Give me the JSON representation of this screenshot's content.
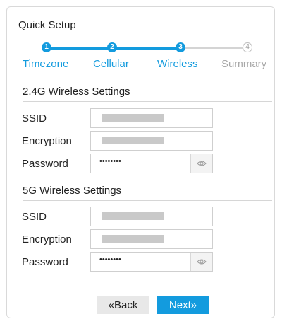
{
  "header": {
    "title": "Quick Setup"
  },
  "stepper": {
    "steps": [
      {
        "number": "1",
        "label": "Timezone"
      },
      {
        "number": "2",
        "label": "Cellular"
      },
      {
        "number": "3",
        "label": "Wireless"
      },
      {
        "number": "4",
        "label": "Summary"
      }
    ],
    "current_step": 3
  },
  "sections": [
    {
      "heading": "2.4G Wireless Settings",
      "fields": {
        "ssid_label": "SSID",
        "encryption_label": "Encryption",
        "password_label": "Password",
        "password_value": "••••••••"
      }
    },
    {
      "heading": "5G Wireless Settings",
      "fields": {
        "ssid_label": "SSID",
        "encryption_label": "Encryption",
        "password_label": "Password",
        "password_value": "••••••••"
      }
    }
  ],
  "buttons": {
    "back": "«Back",
    "next": "Next»"
  },
  "colors": {
    "accent": "#139bde",
    "inactive": "#a8a8a8",
    "border": "#d9d9d9"
  },
  "icons": {
    "password_toggle": "eye-icon"
  }
}
